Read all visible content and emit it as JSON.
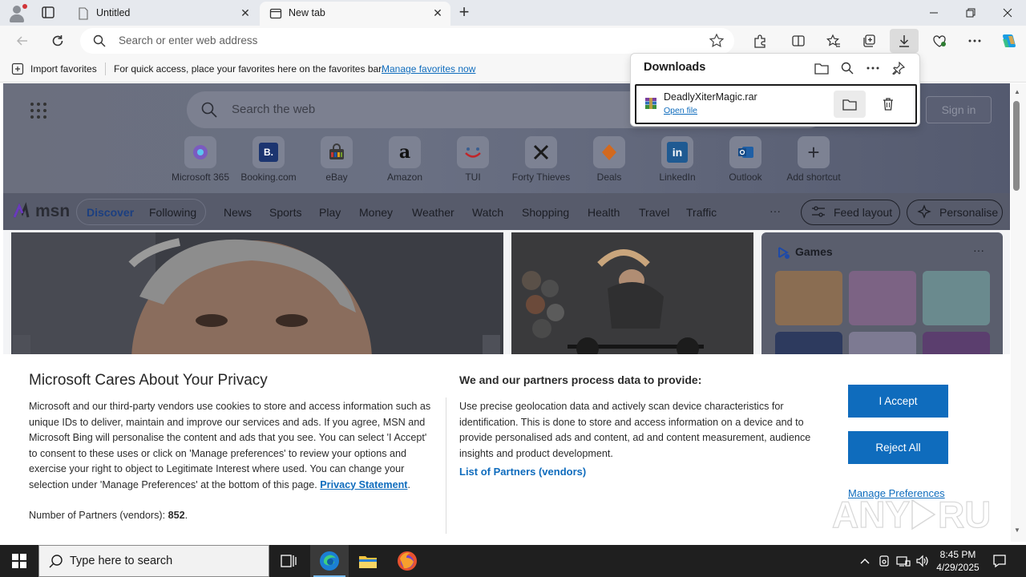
{
  "browser": {
    "tabs": [
      {
        "label": "Untitled",
        "close": "✕"
      },
      {
        "label": "New tab",
        "close": "✕"
      }
    ],
    "new_tab": "+",
    "address": {
      "placeholder": "Search or enter web address"
    }
  },
  "favorites_bar": {
    "import_label": "Import favorites",
    "message": "For quick access, place your favorites here on the favorites bar.",
    "manage_link": "Manage favorites now"
  },
  "downloads": {
    "title": "Downloads",
    "item": {
      "filename": "DeadlyXiterMagic.rar",
      "action": "Open file"
    }
  },
  "newtab": {
    "search_placeholder": "Search the web",
    "sign_in": "Sign in",
    "shortcuts": [
      {
        "label": "Microsoft 365",
        "icon": "microsoft-365-icon"
      },
      {
        "label": "Booking.com",
        "icon": "booking-icon",
        "glyph": "B."
      },
      {
        "label": "eBay",
        "icon": "ebay-icon"
      },
      {
        "label": "Amazon",
        "icon": "amazon-icon",
        "glyph": "a"
      },
      {
        "label": "TUI",
        "icon": "tui-icon"
      },
      {
        "label": "Forty Thieves",
        "icon": "forty-thieves-icon"
      },
      {
        "label": "Deals",
        "icon": "deals-icon"
      },
      {
        "label": "LinkedIn",
        "icon": "linkedin-icon",
        "glyph": "in"
      },
      {
        "label": "Outlook",
        "icon": "outlook-icon"
      },
      {
        "label": "Add shortcut",
        "icon": "plus-icon",
        "glyph": "+"
      }
    ],
    "msn_logo": "msn",
    "nav": {
      "discover": "Discover",
      "following": "Following",
      "links": [
        "News",
        "Sports",
        "Play",
        "Money",
        "Weather",
        "Watch",
        "Shopping",
        "Health",
        "Travel",
        "Traffic"
      ],
      "more": "···",
      "feed_layout": "Feed layout",
      "personalise": "Personalise"
    },
    "games": {
      "title": "Games",
      "more": "···"
    }
  },
  "privacy": {
    "title": "Microsoft Cares About Your Privacy",
    "body": "Microsoft and our third-party vendors use cookies to store and access information such as unique IDs to deliver, maintain and improve our services and ads. If you agree, MSN and Microsoft Bing will personalise the content and ads that you see. You can select 'I Accept' to consent to these uses or click on 'Manage preferences' to review your options and exercise your right to object to Legitimate Interest where used.  You can change your selection under 'Manage Preferences' at the bottom of this page.",
    "privacy_link": "Privacy Statement",
    "partners_label": "Number of Partners (vendors):",
    "partners_count": "852",
    "data_heading": "We and our partners process data to provide:",
    "data_body": "Use precise geolocation data and actively scan device characteristics for identification. This is done to store and access information on a device and to provide personalised ads and content, ad and content measurement, audience insights and product development.",
    "partners_link": "List of Partners (vendors)",
    "accept": "I Accept",
    "reject": "Reject All",
    "manage": "Manage Preferences"
  },
  "taskbar": {
    "search_placeholder": "Type here to search",
    "time": "8:45 PM",
    "date": "4/29/2025"
  },
  "colors": {
    "accent": "#0f6cbd",
    "taskbar": "#1f1f1f"
  }
}
